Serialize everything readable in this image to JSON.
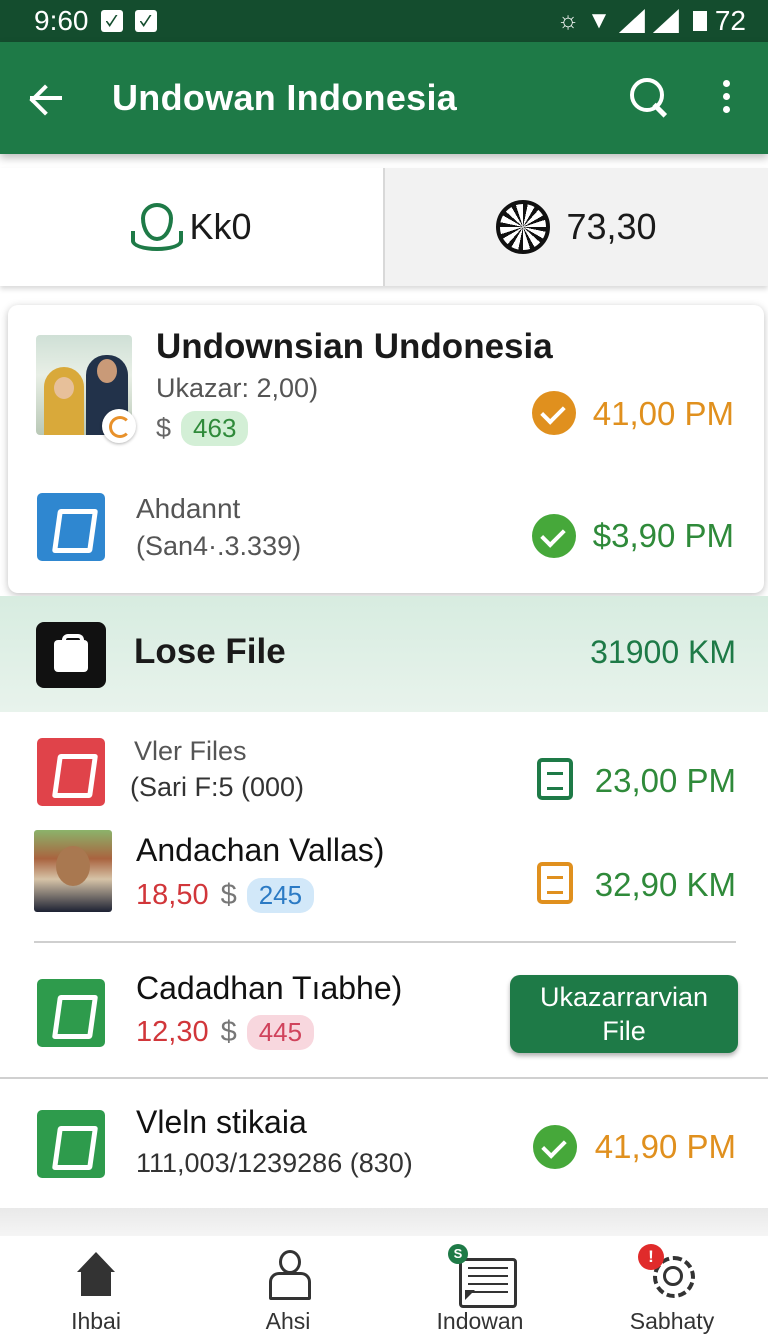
{
  "status_bar": {
    "time": "9:60",
    "battery": "72"
  },
  "app_bar": {
    "title": "Undowan Indonesia"
  },
  "summary": {
    "left_value": "Kk0",
    "right_value": "73,30"
  },
  "card": {
    "name": "Undownsian Undonesia",
    "subtitle": "Ukazar: 2,00)",
    "currency": "$",
    "badge": "463",
    "time1": "41,00 PM",
    "item2_title": "Ahdannt",
    "item2_sub": "(San4·.3.339)",
    "time2": "$3,90 PM"
  },
  "band": {
    "label": "Lose File",
    "value": "31900 KM"
  },
  "list": {
    "row1_title": "Vler Files",
    "row1_sub": "(Sari F:5 (000)",
    "row1_time": "23,00 PM",
    "row2_name": "Andachan Vallas)",
    "row2_price": "18,50",
    "row2_currency": "$",
    "row2_badge": "245",
    "row2_time": "32,90 KM",
    "row3_name": "Cadadhan Tıabhe)",
    "row3_price": "12,30",
    "row3_currency": "$",
    "row3_badge": "445",
    "row3_button_line1": "Ukazarrarvian",
    "row3_button_line2": "File",
    "row4_name": "Vleln stikaia",
    "row4_sub": "111,003/1239286 (830)",
    "row4_time": "41,90 PM"
  },
  "bottom_nav": {
    "items": [
      {
        "label": "Ihbai"
      },
      {
        "label": "Ahsi"
      },
      {
        "label": "Indowan",
        "badge": "S"
      },
      {
        "label": "Sabhaty",
        "badge": "!"
      }
    ]
  },
  "colors": {
    "primary": "#1e7a47",
    "status_bar": "#144d2e",
    "accent_orange": "#e0901e",
    "accent_red": "#d1363a"
  }
}
